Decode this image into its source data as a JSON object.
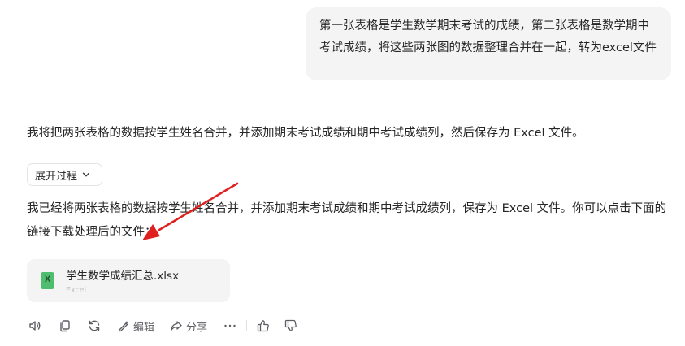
{
  "user_message": {
    "text": "第一张表格是学生数学期末考试的成绩，第二张表格是数学期中考试成绩，将这些两张图的数据整理合并在一起，转为excel文件"
  },
  "assistant": {
    "intro": "我将把两张表格的数据按学生姓名合并，并添加期末考试成绩和期中考试成绩列，然后保存为 Excel 文件。",
    "expand_label": "展开过程",
    "reply": "我已经将两张表格的数据按学生姓名合并，并添加期末考试成绩和期中考试成绩列，保存为 Excel 文件。你可以点击下面的链接下载处理后的文件：",
    "file": {
      "name": "学生数学成绩汇总.xlsx",
      "type": "Excel",
      "icon_letter": "X",
      "icon": "excel-file-icon"
    }
  },
  "toolbar": {
    "edit_label": "编辑",
    "share_label": "分享",
    "icons": [
      "speaker-icon",
      "copy-icon",
      "regenerate-icon",
      "edit-icon",
      "share-icon",
      "more-icon",
      "thumbs-up-icon",
      "thumbs-down-icon"
    ]
  },
  "colors": {
    "bubble_bg": "#f4f4f5",
    "card_bg": "#f4f4f5",
    "excel_green": "#4fbd6f",
    "annotation_red": "#e02020",
    "icon_gray": "#5c5c63"
  }
}
